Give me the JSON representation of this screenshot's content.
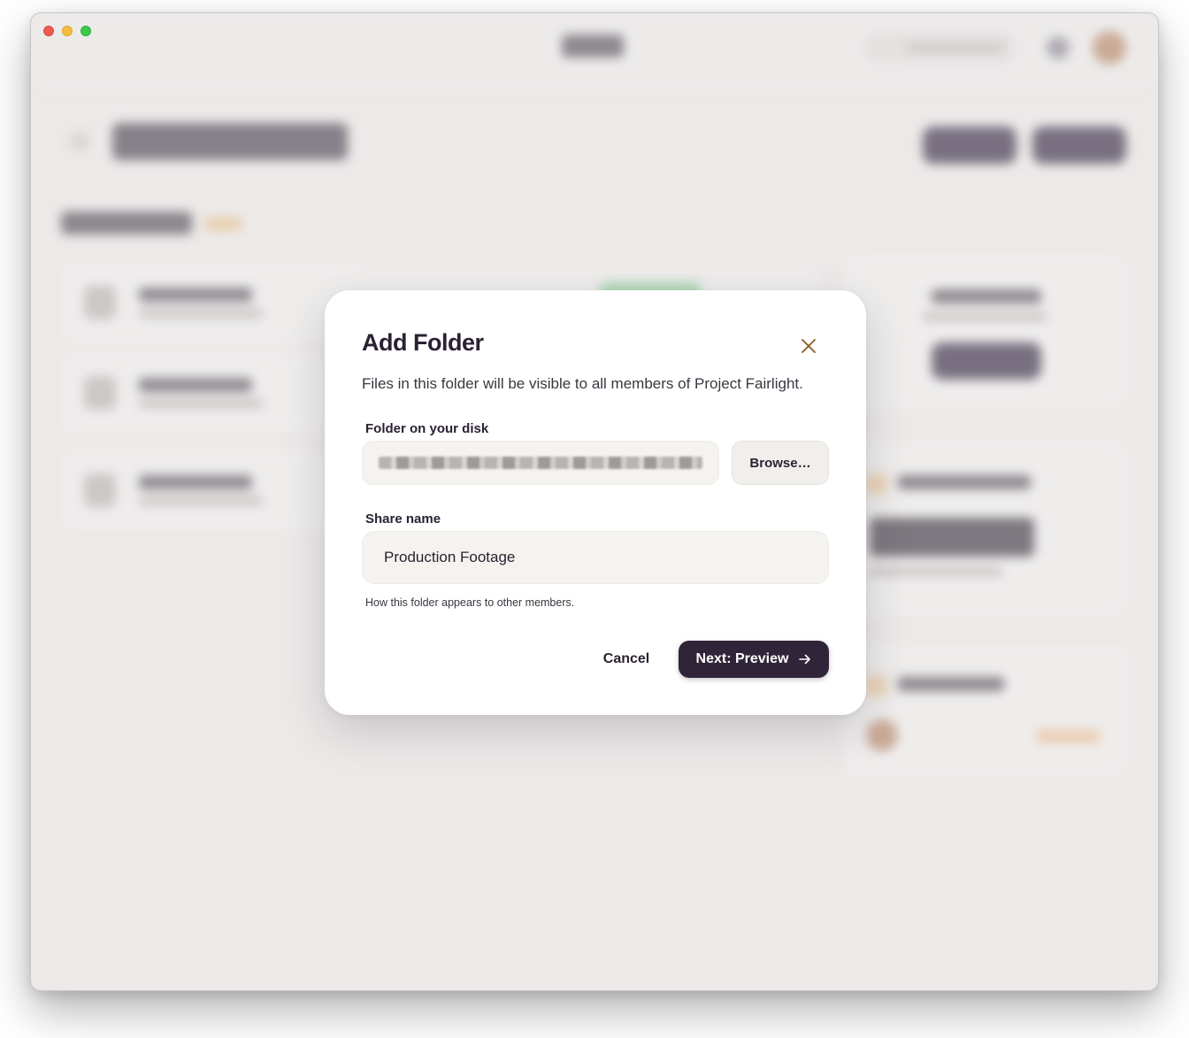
{
  "modal": {
    "title": "Add Folder",
    "description": "Files in this folder will be visible to all members of Project Fairlight.",
    "folder_label": "Folder on your disk",
    "browse_label": "Browse…",
    "share_name_label": "Share name",
    "share_name_value": "Production Footage",
    "hint": "How this folder appears to other members.",
    "cancel_label": "Cancel",
    "next_label": "Next: Preview",
    "icons": {
      "close": "close-icon",
      "next": "arrow-right-icon"
    }
  },
  "colors": {
    "primary": "#2f2438",
    "close_icon": "#8a5a1f",
    "window_bg": "#ebe9e7",
    "input_bg": "#f5f3ef"
  }
}
